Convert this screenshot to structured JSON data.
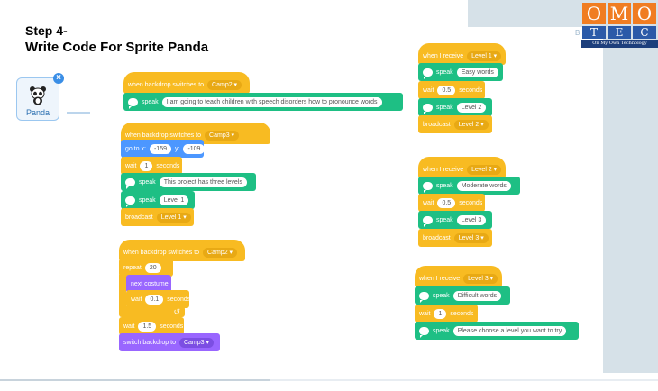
{
  "title": {
    "line1": "Step 4-",
    "line2": "Write Code For Sprite Panda"
  },
  "sprite": {
    "label": "Panda",
    "close": "×",
    "icon": "panda-icon"
  },
  "logo": {
    "top": [
      "O",
      "M",
      "O"
    ],
    "bottom": [
      "T",
      "E",
      "C"
    ],
    "tagline": "On My Own Technology",
    "colors": {
      "orange": "#f07d22",
      "blue": "#2b5aa8"
    }
  },
  "stray": {
    "label": "B"
  },
  "scripts": {
    "s1": {
      "hat": "when backdrop switches to",
      "hat_value": "Camp2 ▾",
      "speak": "speak",
      "speak_text": "I am going to teach children with speech disorders how to pronounce words"
    },
    "s2": {
      "hat": "when backdrop switches to",
      "hat_value": "Camp3 ▾",
      "goto": "go to x:",
      "x": "-159",
      "y_label": "y:",
      "y": "-109",
      "wait": "wait",
      "wait_val": "1",
      "seconds": "seconds",
      "speak1": "speak",
      "speak1_text": "This project has three levels",
      "speak2": "speak",
      "speak2_text": "Level 1",
      "broadcast": "broadcast",
      "broadcast_val": "Level 1 ▾"
    },
    "s3": {
      "hat": "when backdrop switches to",
      "hat_value": "Camp2 ▾",
      "repeat": "repeat",
      "repeat_val": "20",
      "next_costume": "next costume",
      "inner_wait": "wait",
      "inner_wait_val": "0.1",
      "seconds": "seconds",
      "loop_arrow": "↺",
      "wait": "wait",
      "wait_val": "1.5",
      "seconds2": "seconds",
      "switch": "switch backdrop to",
      "switch_val": "Camp3 ▾"
    },
    "s4": {
      "hat": "when I receive",
      "hat_value": "Level 1 ▾",
      "speak1": "speak",
      "speak1_text": "Easy words",
      "wait": "wait",
      "wait_val": "0.5",
      "seconds": "seconds",
      "speak2": "speak",
      "speak2_text": "Level 2",
      "broadcast": "broadcast",
      "broadcast_val": "Level 2 ▾"
    },
    "s5": {
      "hat": "when I receive",
      "hat_value": "Level 2 ▾",
      "speak1": "speak",
      "speak1_text": "Moderate words",
      "wait": "wait",
      "wait_val": "0.5",
      "seconds": "seconds",
      "speak2": "speak",
      "speak2_text": "Level 3",
      "broadcast": "broadcast",
      "broadcast_val": "Level 3 ▾"
    },
    "s6": {
      "hat": "when I receive",
      "hat_value": "Level 3 ▾",
      "speak1": "speak",
      "speak1_text": "Difficult words",
      "wait": "wait",
      "wait_val": "1",
      "seconds": "seconds",
      "speak2": "speak",
      "speak2_text": "Please choose a level you want to try"
    }
  }
}
